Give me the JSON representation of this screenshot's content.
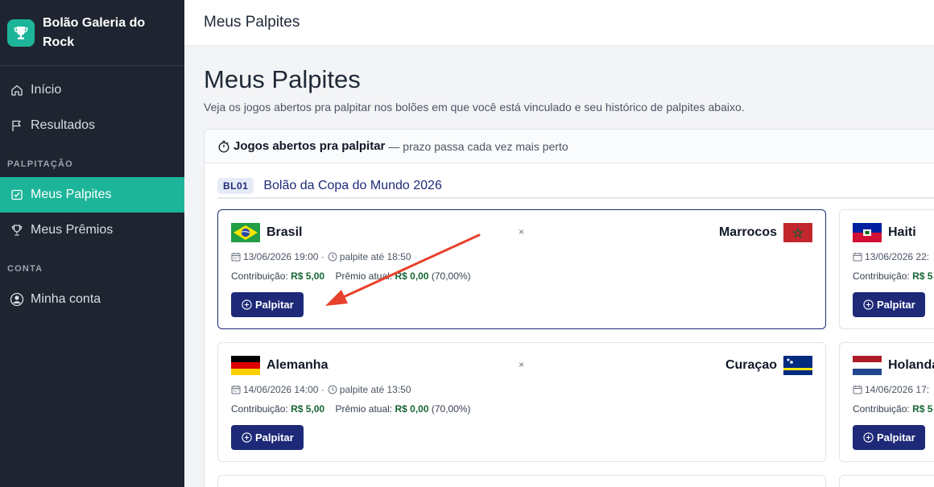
{
  "app": {
    "title": "Bolão Galeria do Rock"
  },
  "sidebar": {
    "items": [
      {
        "label": "Início"
      },
      {
        "label": "Resultados"
      },
      {
        "label": "Meus Palpites"
      },
      {
        "label": "Meus Prêmios"
      },
      {
        "label": "Minha conta"
      }
    ],
    "sections": {
      "palpitacao": "PALPITAÇÃO",
      "conta": "CONTA"
    }
  },
  "topbar": {
    "title": "Meus Palpites"
  },
  "page": {
    "title": "Meus Palpites",
    "subtitle": "Veja os jogos abertos pra palpitar nos bolões em que você está vinculado e seu histórico de palpites abaixo."
  },
  "panel": {
    "title": "Jogos abertos pra palpitar",
    "subtitle": "— prazo passa cada vez mais perto"
  },
  "bolao": {
    "code": "BL01",
    "name": "Bolão da Copa do Mundo 2026"
  },
  "games": [
    {
      "home": "Brasil",
      "away": "Marrocos",
      "vs": "×",
      "date": "13/06/2026 19:00 ·",
      "deadline": "palpite até 18:50",
      "contrib_label": "Contribuição:",
      "contrib_value": "R$ 5,00",
      "prize_label": "Prêmio atual:",
      "prize_value": "R$ 0,00",
      "prize_pct": "(70,00%)",
      "button": "Palpitar"
    },
    {
      "home": "Alemanha",
      "away": "Curaçao",
      "vs": "×",
      "date": "14/06/2026 14:00 ·",
      "deadline": "palpite até 13:50",
      "contrib_label": "Contribuição:",
      "contrib_value": "R$ 5,00",
      "prize_label": "Prêmio atual:",
      "prize_value": "R$ 0,00",
      "prize_pct": "(70,00%)",
      "button": "Palpitar"
    }
  ],
  "games_partial": [
    {
      "home": "Haiti",
      "date": "13/06/2026 22:",
      "contrib_label": "Contribuição:",
      "contrib_value": "R$ 5",
      "button": "Palpitar"
    },
    {
      "home": "Holanda",
      "date": "14/06/2026 17:",
      "contrib_label": "Contribuição:",
      "contrib_value": "R$ 5",
      "button": "Palpitar"
    }
  ],
  "colors": {
    "accent": "#1db59a",
    "primary": "#1e2a78",
    "sidebar": "#1f2530",
    "money": "#166534",
    "annotation": "#e8412c"
  }
}
